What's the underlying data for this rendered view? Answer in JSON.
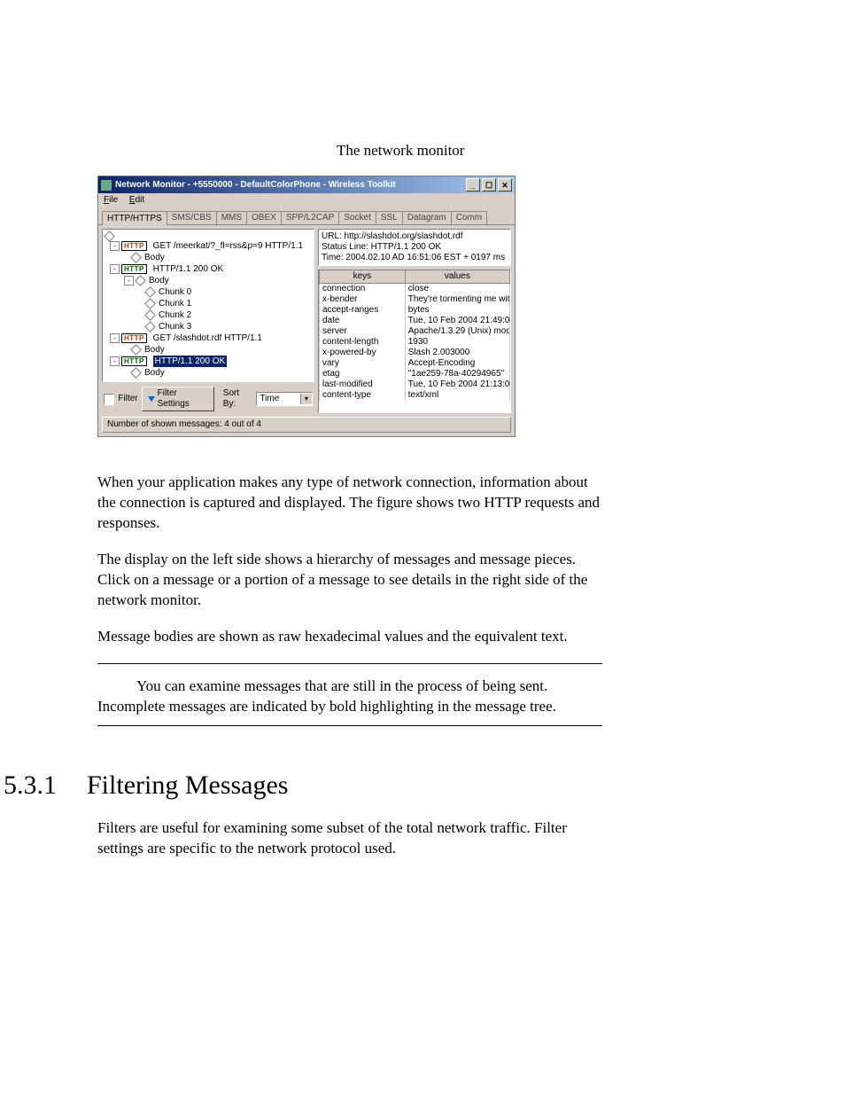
{
  "caption": "The network monitor",
  "window": {
    "title": "Network Monitor - +5550000 - DefaultColorPhone - Wireless Toolkit",
    "menus": {
      "file": "File",
      "edit": "Edit"
    },
    "tabs": [
      "HTTP/HTTPS",
      "SMS/CBS",
      "MMS",
      "OBEX",
      "SPP/L2CAP",
      "Socket",
      "SSL",
      "Datagram",
      "Comm"
    ],
    "tree": {
      "r1_badge": "HTTP",
      "r1_text": "GET /meerkat/?_fl=rss&p=9 HTTP/1.1",
      "r1b": "Body",
      "r2_badge": "HTTP",
      "r2_text": "HTTP/1.1 200 OK",
      "r2b": "Body",
      "c0": "Chunk 0",
      "c1": "Chunk 1",
      "c2": "Chunk 2",
      "c3": "Chunk 3",
      "r3_badge": "HTTP",
      "r3_text": "GET /slashdot.rdf HTTP/1.1",
      "r3b": "Body",
      "r4_badge": "HTTP",
      "r4_text": "HTTP/1.1 200 OK",
      "r4b": "Body"
    },
    "footer": {
      "filter_label": "Filter",
      "filter_settings": "Filter Settings",
      "sortby_label": "Sort By:",
      "sortby_value": "Time"
    },
    "details": {
      "url": "URL: http://slashdot.org/slashdot.rdf",
      "status": "Status Line: HTTP/1.1 200 OK",
      "time": "Time: 2004.02.10 AD  16:51:06 EST + 0197 ms"
    },
    "kv_headers": {
      "keys": "keys",
      "values": "values"
    },
    "kv_rows": [
      {
        "k": "connection",
        "v": "close"
      },
      {
        "k": "x-bender",
        "v": "They're tormenting me wit..."
      },
      {
        "k": "accept-ranges",
        "v": "bytes"
      },
      {
        "k": "date",
        "v": "Tue, 10 Feb 2004 21:49:0..."
      },
      {
        "k": "server",
        "v": "Apache/1.3.29 (Unix) mod..."
      },
      {
        "k": "content-length",
        "v": "1930"
      },
      {
        "k": "x-powered-by",
        "v": "Slash 2.003000"
      },
      {
        "k": "vary",
        "v": "Accept-Encoding"
      },
      {
        "k": "etag",
        "v": "\"1ae259-78a-40294965\""
      },
      {
        "k": "last-modified",
        "v": "Tue, 10 Feb 2004 21:13:0..."
      },
      {
        "k": "content-type",
        "v": "text/xml"
      }
    ],
    "status_strip": "Number of shown messages: 4 out of 4"
  },
  "paras": {
    "p1": "When your application makes any type of network connection, information about the connection is captured and displayed. The figure shows two HTTP requests and responses.",
    "p2": "The display on the left side shows a hierarchy of messages and message pieces. Click on a message or a portion of a message to see details in the right side of the network monitor.",
    "p3": "Message bodies are shown as raw hexadecimal values and the equivalent text.",
    "note": "You can examine messages that are still in the process of being sent. Incomplete messages are indicated by bold highlighting in the message tree."
  },
  "section": {
    "num": "5.3.1",
    "title": "Filtering Messages",
    "para": "Filters are useful for examining some subset of the total network traffic. Filter settings are specific to the network protocol used."
  }
}
